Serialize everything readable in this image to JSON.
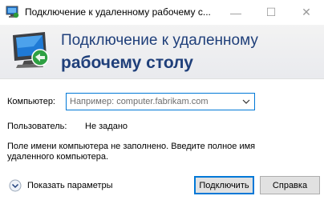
{
  "window": {
    "title": "Подключение к удаленному рабочему с...",
    "minimize_glyph": "—",
    "maximize_glyph": "☐",
    "close_glyph": "✕"
  },
  "banner": {
    "line1": "Подключение к удаленному",
    "line2": "рабочему столу",
    "icon": "remote-desktop-icon"
  },
  "form": {
    "computer_label": "Компьютер:",
    "computer_value": "",
    "computer_placeholder": "Например: computer.fabrikam.com",
    "user_label": "Пользователь:",
    "user_value": "Не задано",
    "message": "Поле имени компьютера не заполнено. Введите полное имя удаленного компьютера."
  },
  "footer": {
    "show_options_label": "Показать параметры",
    "connect_label": "Подключить",
    "help_label": "Справка"
  },
  "colors": {
    "banner_text": "#1f3f7a",
    "focus_border": "#0078d7"
  }
}
